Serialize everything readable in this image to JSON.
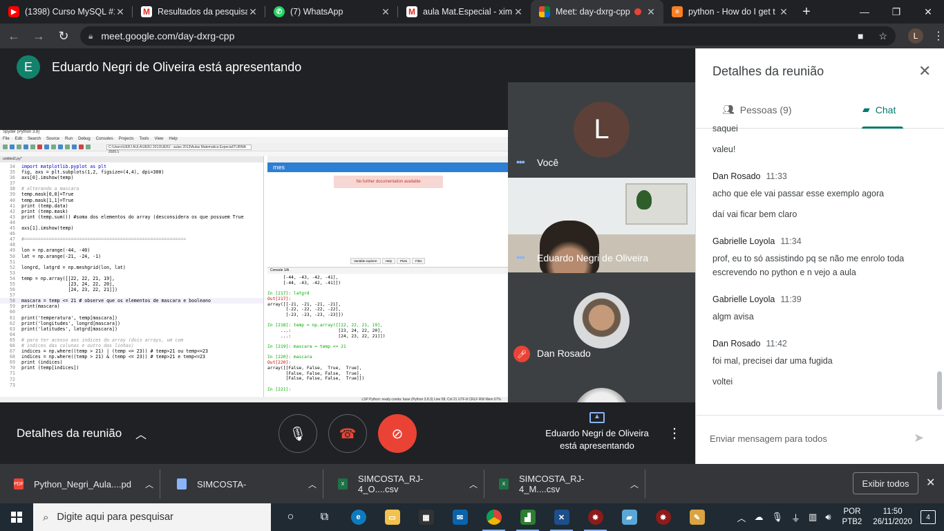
{
  "browser": {
    "tabs": [
      {
        "title": "(1398) Curso MySQL #1",
        "icon": "youtube-icon"
      },
      {
        "title": "Resultados da pesquisa",
        "icon": "gmail-icon"
      },
      {
        "title": "(7) WhatsApp",
        "icon": "whatsapp-icon"
      },
      {
        "title": "aula Mat.Especial - xim",
        "icon": "gmail-icon"
      },
      {
        "title": "Meet: day-dxrg-cpp",
        "icon": "meet-icon"
      },
      {
        "title": "python - How do I get t",
        "icon": "stackoverflow-icon"
      }
    ],
    "url": "meet.google.com/day-dxrg-cpp",
    "profile_initial": "L"
  },
  "meet": {
    "presenter_initial": "E",
    "presenter_banner": "Eduardo Negri de Oliveira está apresentando",
    "participants": [
      {
        "name": "Você",
        "initial": "L"
      },
      {
        "name": "Eduardo Negri de Oliveira"
      },
      {
        "name": "Dan Rosado"
      }
    ],
    "controls": {
      "details_label": "Detalhes da reunião",
      "presenting_label": "Eduardo Negri de Oliveira está apresentando"
    }
  },
  "screen_share": {
    "window_title": "Spyder (Python 3.8)",
    "menu": [
      "File",
      "Edit",
      "Search",
      "Source",
      "Run",
      "Debug",
      "Consoles",
      "Projects",
      "Tools",
      "View",
      "Help"
    ],
    "path": "C:\\Users\\UERJ AULA\\UERJ 2013\\UERJ - aulas 2013\\Aulas Matematica Especial\\TURMA 2020.1",
    "editor_tab": "untitled2.py*",
    "help_heading": "mes",
    "help_message": "No further documentation available",
    "help_tabs": [
      "Variable explorer",
      "Help",
      "Plots",
      "Files"
    ],
    "console_tab": "Console 1/A",
    "code_lines": [
      {
        "n": "34",
        "text": "import matplotlib.pyplot as plt"
      },
      {
        "n": "35",
        "text": "fig, axs = plt.subplots(1,2, figsize=(4,4), dpi=300)"
      },
      {
        "n": "36",
        "text": "axs[0].imshow(temp)"
      },
      {
        "n": "37",
        "text": ""
      },
      {
        "n": "38",
        "text": "# alterando a mascara"
      },
      {
        "n": "39",
        "text": "temp.mask[0,0]=True"
      },
      {
        "n": "40",
        "text": "temp.mask[1,1]=True"
      },
      {
        "n": "41",
        "text": "print (temp.data)"
      },
      {
        "n": "42",
        "text": "print (temp.mask)"
      },
      {
        "n": "43",
        "text": "print (temp.sum()) #soma dos elementos do array (desconsidera os que possuem True"
      },
      {
        "n": "44",
        "text": ""
      },
      {
        "n": "45",
        "text": "axs[1].imshow(temp)"
      },
      {
        "n": "46",
        "text": ""
      },
      {
        "n": "47",
        "text": "#==========================================================="
      },
      {
        "n": "48",
        "text": ""
      },
      {
        "n": "49",
        "text": "lon = np.arange(-44, -40)"
      },
      {
        "n": "50",
        "text": "lat = np.arange(-21, -24, -1)"
      },
      {
        "n": "51",
        "text": ""
      },
      {
        "n": "52",
        "text": "longrd, latgrd = np.meshgrid(lon, lat)"
      },
      {
        "n": "53",
        "text": ""
      },
      {
        "n": "54",
        "text": "temp = np.array([[22, 22, 21, 19],"
      },
      {
        "n": "55",
        "text": "                 [23, 24, 22, 20],"
      },
      {
        "n": "56",
        "text": "                 [24, 23, 22, 21]])"
      },
      {
        "n": "57",
        "text": ""
      },
      {
        "n": "58",
        "text": "mascara = temp <= 21 # observe que os elementos de mascara e booleano"
      },
      {
        "n": "59",
        "text": "print(mascara)"
      },
      {
        "n": "60",
        "text": ""
      },
      {
        "n": "61",
        "text": "print('temperatura', temp[mascara])"
      },
      {
        "n": "62",
        "text": "print('longitudes', longrd[mascara])"
      },
      {
        "n": "63",
        "text": "print('latitudes', latgrd[mascara])"
      },
      {
        "n": "64",
        "text": ""
      },
      {
        "n": "65",
        "text": "# para ter acesso aos indices do array (dois arrays, um com"
      },
      {
        "n": "66",
        "text": "# indices das colunas e outro das linhas)"
      },
      {
        "n": "67",
        "text": "indices = np.where((temp > 21) | (temp <= 23)) # temp>21 ou temp<=23"
      },
      {
        "n": "68",
        "text": "indices = np.where((temp > 21) & (temp <= 23)) # temp>21 e temp<=23"
      },
      {
        "n": "69",
        "text": "print (indices)"
      },
      {
        "n": "70",
        "text": "print (temp[indices])"
      },
      {
        "n": "71",
        "text": ""
      },
      {
        "n": "72",
        "text": ""
      },
      {
        "n": "73",
        "text": ""
      }
    ],
    "console_lines": [
      "      [-44, -43, -42, -41],",
      "      [-44, -43, -42, -41]])",
      "",
      "In [217]: latgrd",
      "Out[217]:",
      "array([[-21, -21, -21, -21],",
      "       [-22, -22, -22, -22],",
      "       [-23, -23, -23, -23]])",
      "",
      "In [218]: temp = np.array([[22, 22, 21, 19],",
      "     ...:                  [23, 24, 22, 20],",
      "     ...:                  [24, 23, 22, 21]])",
      "",
      "In [219]: mascara = temp <= 21",
      "",
      "In [220]: mascara",
      "Out[220]:",
      "array([[False, False,  True,  True],",
      "       [False, False, False,  True],",
      "       [False, False, False,  True]])",
      "",
      "In [221]:"
    ],
    "console_bottom_tabs": [
      "IPython console",
      "History"
    ],
    "status": "LSP Python: ready   conda: base (Python 3.8.3)   Line 58, Col 21   UTF-8   CRLF   RW   Mem 67%"
  },
  "panel": {
    "title": "Detalhes da reunião",
    "tab_people": "Pessoas (9)",
    "tab_chat": "Chat",
    "messages": [
      {
        "author": "",
        "time": "",
        "lines": [
          "saquei",
          "valeu!"
        ]
      },
      {
        "author": "Dan Rosado",
        "time": "11:33",
        "lines": [
          "acho que ele vai passar esse exemplo agora",
          "daí vai ficar bem claro"
        ]
      },
      {
        "author": "Gabrielle Loyola",
        "time": "11:34",
        "lines": [
          "prof, eu to só assistindo pq se não me enrolo toda escrevendo no python e n vejo a aula"
        ]
      },
      {
        "author": "Gabrielle Loyola",
        "time": "11:39",
        "lines": [
          "algm avisa"
        ]
      },
      {
        "author": "Dan Rosado",
        "time": "11:42",
        "lines": [
          "foi mal, precisei dar uma fugida",
          "voltei"
        ]
      }
    ],
    "composer_placeholder": "Enviar mensagem para todos"
  },
  "downloads": {
    "items": [
      {
        "name": "Python_Negri_Aula....pd",
        "type": "pdf"
      },
      {
        "name": "SIMCOSTA-",
        "type": "gen"
      },
      {
        "name": "SIMCOSTA_RJ-4_O....csv",
        "type": "xls"
      },
      {
        "name": "SIMCOSTA_RJ-4_M....csv",
        "type": "xls"
      }
    ],
    "show_all": "Exibir todos"
  },
  "taskbar": {
    "search_placeholder": "Digite aqui para pesquisar",
    "lang_top": "POR",
    "lang_bottom": "PTB2",
    "time": "11:50",
    "date": "26/11/2020",
    "notifications": "4"
  },
  "colors": {
    "meet_dark": "#202124",
    "accent_teal": "#00796b",
    "danger": "#ea4335"
  }
}
